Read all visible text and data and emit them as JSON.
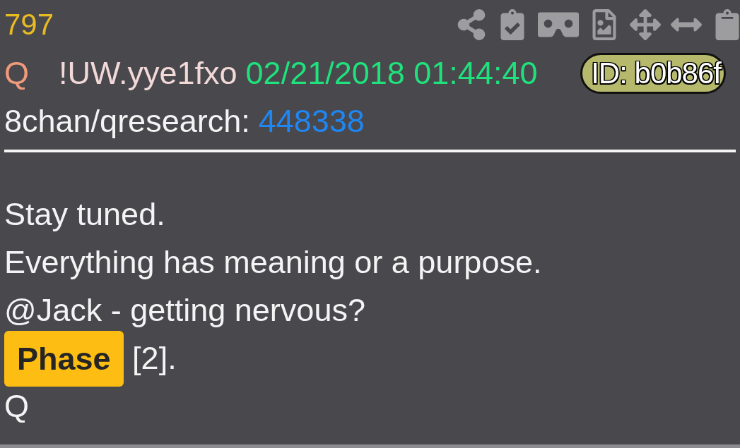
{
  "post_number": "797",
  "author": {
    "name": "Q",
    "tripcode": "!UW.yye1fxo",
    "timestamp": "02/21/2018 01:44:40",
    "id": "ID: b0b86f"
  },
  "source": {
    "board": "8chan/qresearch:",
    "thread": "448338"
  },
  "body": [
    {
      "segments": [
        {
          "text": "Stay tuned.",
          "highlighted": false
        }
      ]
    },
    {
      "segments": [
        {
          "text": "Everything has meaning or a purpose.",
          "highlighted": false
        }
      ]
    },
    {
      "segments": [
        {
          "text": "@Jack - getting nervous?",
          "highlighted": false
        }
      ]
    },
    {
      "segments": [
        {
          "text": "Phase",
          "highlighted": true
        },
        {
          "text": " [2].",
          "highlighted": false
        }
      ]
    },
    {
      "segments": [
        {
          "text": "Q",
          "highlighted": false
        }
      ]
    }
  ]
}
